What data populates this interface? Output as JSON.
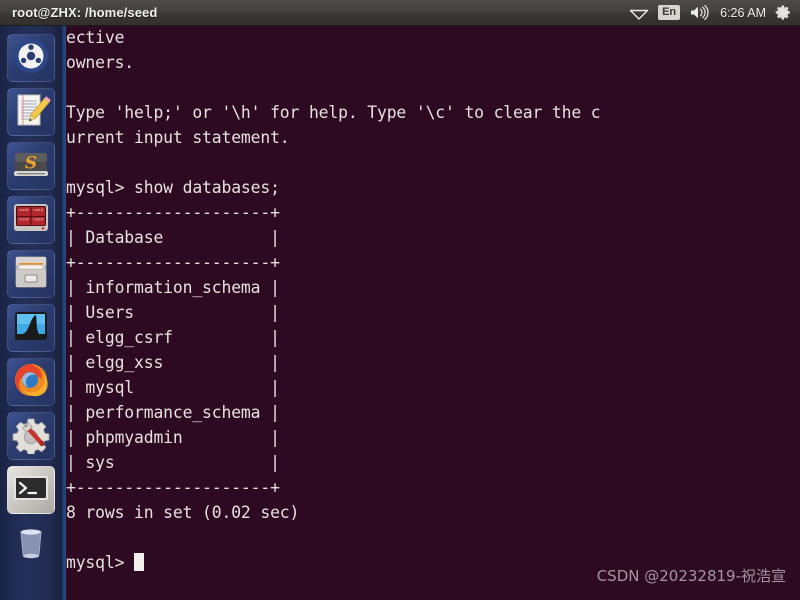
{
  "panel": {
    "title": "root@ZHX: /home/seed",
    "tray": {
      "network_icon": "wifi-icon",
      "keyboard_label": "En",
      "volume_icon": "volume-icon",
      "clock": "6:26 AM",
      "settings_icon": "gear-icon"
    }
  },
  "launcher": {
    "items": [
      {
        "name": "ubuntu-dash",
        "icon": "ubuntu-logo-icon",
        "active": false
      },
      {
        "name": "text-editor",
        "icon": "document-pencil-icon",
        "active": false
      },
      {
        "name": "sublime-text",
        "icon": "sublime-s-icon",
        "active": false
      },
      {
        "name": "terminator",
        "icon": "red-quad-terminal-icon",
        "active": false
      },
      {
        "name": "file-archiver",
        "icon": "file-cabinet-icon",
        "active": false
      },
      {
        "name": "wireshark",
        "icon": "shark-fin-icon",
        "active": false
      },
      {
        "name": "firefox",
        "icon": "firefox-icon",
        "active": false
      },
      {
        "name": "system-settings",
        "icon": "gear-wrench-icon",
        "active": false
      },
      {
        "name": "terminal",
        "icon": "terminal-prompt-icon",
        "active": true
      },
      {
        "name": "trash",
        "icon": "trash-bin-icon",
        "active": false
      }
    ]
  },
  "terminal": {
    "colors": {
      "background": "#2D0922",
      "foreground": "#E6E2DE"
    },
    "lines": [
      "ective",
      "owners.",
      "",
      "Type 'help;' or '\\h' for help. Type '\\c' to clear the c",
      "urrent input statement.",
      "",
      "mysql> show databases;",
      "+--------------------+",
      "| Database           |",
      "+--------------------+",
      "| information_schema |",
      "| Users              |",
      "| elgg_csrf          |",
      "| elgg_xss           |",
      "| mysql              |",
      "| performance_schema |",
      "| phpmyadmin         |",
      "| sys                |",
      "+--------------------+",
      "8 rows in set (0.02 sec)",
      "",
      "mysql> "
    ],
    "prompt": "mysql> ",
    "command": "show databases;",
    "result_table": {
      "header": "Database",
      "rows": [
        "information_schema",
        "Users",
        "elgg_csrf",
        "elgg_xss",
        "mysql",
        "performance_schema",
        "phpmyadmin",
        "sys"
      ],
      "status": "8 rows in set (0.02 sec)"
    }
  },
  "watermark": "CSDN @20232819-祝浩宣"
}
